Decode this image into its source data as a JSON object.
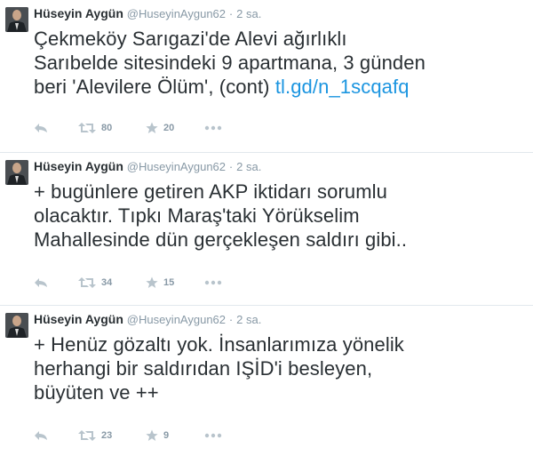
{
  "tweets": [
    {
      "fullname": "Hüseyin Aygün",
      "username": "@HuseyinAygun62",
      "dot": "·",
      "time": "2 sa.",
      "text_lines": [
        "Çekmeköy Sarıgazi'de Alevi ağırlıklı",
        "Sarıbelde sitesindeki 9 apartmana, 3 günden",
        "beri 'Alevilere Ölüm', (cont) "
      ],
      "link": "tl.gd/n_1scqafq",
      "retweets": "80",
      "favorites": "20"
    },
    {
      "fullname": "Hüseyin Aygün",
      "username": "@HuseyinAygun62",
      "dot": "·",
      "time": "2 sa.",
      "text_lines": [
        "+ bugünlere getiren AKP iktidarı sorumlu",
        "olacaktır. Tıpkı Maraş'taki Yörükselim",
        "Mahallesinde dün gerçekleşen saldırı gibi.."
      ],
      "retweets": "34",
      "favorites": "15"
    },
    {
      "fullname": "Hüseyin Aygün",
      "username": "@HuseyinAygun62",
      "dot": "·",
      "time": "2 sa.",
      "text_lines": [
        "+ Henüz gözaltı yok. İnsanlarımıza yönelik",
        "herhangi bir saldırıdan IŞİD'i besleyen,",
        "büyüten ve ++"
      ],
      "retweets": "23",
      "favorites": "9"
    }
  ],
  "icons": {
    "reply": "reply-icon",
    "retweet": "retweet-icon",
    "favorite": "star-icon",
    "more": "more-icon"
  },
  "colors": {
    "link": "#1b95e0",
    "muted": "#8899a6",
    "text": "#292f33",
    "divider": "#e1e8ed"
  }
}
